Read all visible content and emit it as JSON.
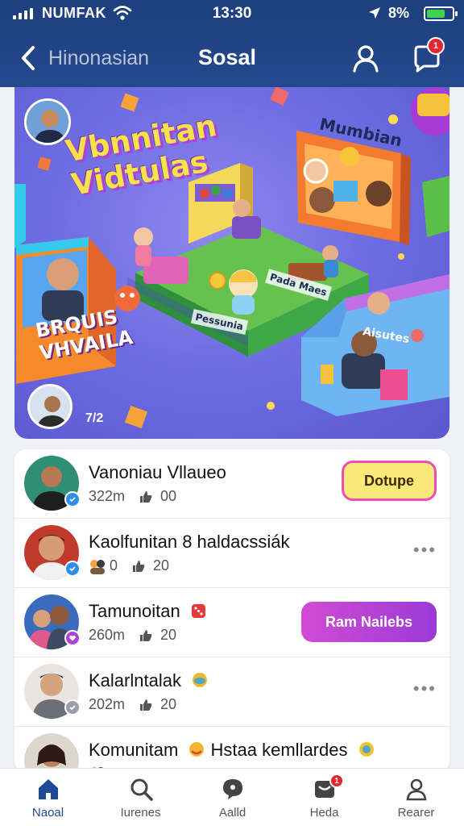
{
  "status_bar": {
    "carrier": "NUMFAK",
    "time": "13:30",
    "battery_text": "8%",
    "battery_color": "#3fd24a"
  },
  "header": {
    "back_label": "Hinonasian",
    "title": "Sosal",
    "chat_badge": "1",
    "background": "#1d3f7e"
  },
  "hero": {
    "title_line1": "Vbnnitan",
    "title_line2": "Vidtulas",
    "badge_top_right": "Mumbian",
    "panel_left_line1": "BRQUIS",
    "panel_left_line2": "VHVAILA",
    "sign_1": "Pada Maes",
    "sign_2": "Pessunia",
    "sign_3": "Aisutes",
    "page_indicator": "7/2"
  },
  "communities": [
    {
      "name": "Vanoniau Vllaueo",
      "members": "322m",
      "likes": "00",
      "action": "Dotupe",
      "avatar_color": "#2e8f76"
    },
    {
      "name": "Kaolfunitan 8 haldacssiák",
      "members": "0",
      "likes": "20",
      "action": "•••",
      "avatar_color": "#c0392b"
    },
    {
      "name": "Tamunoitan",
      "members": "260m",
      "likes": "20",
      "action": "Ram Nailebs",
      "avatar_color": "#3a6bbd"
    },
    {
      "name": "Kalarlntalak",
      "members": "202m",
      "likes": "20",
      "action": "•••",
      "avatar_color": "#b08a66"
    },
    {
      "name": "Komunitam",
      "name_suffix": "Hstaa kemllardes",
      "members": "",
      "likes": "",
      "action": "",
      "avatar_color": "#8b5a3c"
    }
  ],
  "bottom_nav": [
    {
      "label": "Naoal",
      "icon": "home-icon",
      "active": true
    },
    {
      "label": "Iurenes",
      "icon": "search-icon",
      "active": false
    },
    {
      "label": "Aalld",
      "icon": "chat-bubble-icon",
      "active": false
    },
    {
      "label": "Heda",
      "icon": "inbox-icon",
      "active": false,
      "badge": "1"
    },
    {
      "label": "Rearer",
      "icon": "profile-icon",
      "active": false
    }
  ],
  "colors": {
    "accent": "#1f4a95",
    "cta_yellow": "#fbe97a",
    "cta_purple": "#b042d6",
    "notification": "#e3262f"
  }
}
